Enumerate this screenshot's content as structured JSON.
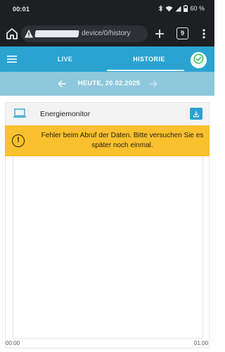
{
  "status_bar": {
    "time": "00:01",
    "battery": "60 %"
  },
  "browser": {
    "url_suffix": "device/0/history",
    "tab_count": "9"
  },
  "app_header": {
    "tabs": [
      {
        "label": "LIVE"
      },
      {
        "label": "HISTORIE"
      }
    ],
    "active_tab": "HISTORIE"
  },
  "date_nav": {
    "date_label": "HEUTE, 20.02.2025"
  },
  "card": {
    "title": "Energiemonitor",
    "error_message": "Fehler beim Abruf der Daten. Bitte versuchen Sie es später noch einmal."
  },
  "x_axis": {
    "start_label": "00:00",
    "end_label": "01:00"
  },
  "colors": {
    "accent": "#2aa3d1",
    "date_bar": "#8ec8dc",
    "warning": "#fbc02d",
    "success": "#34c759"
  }
}
